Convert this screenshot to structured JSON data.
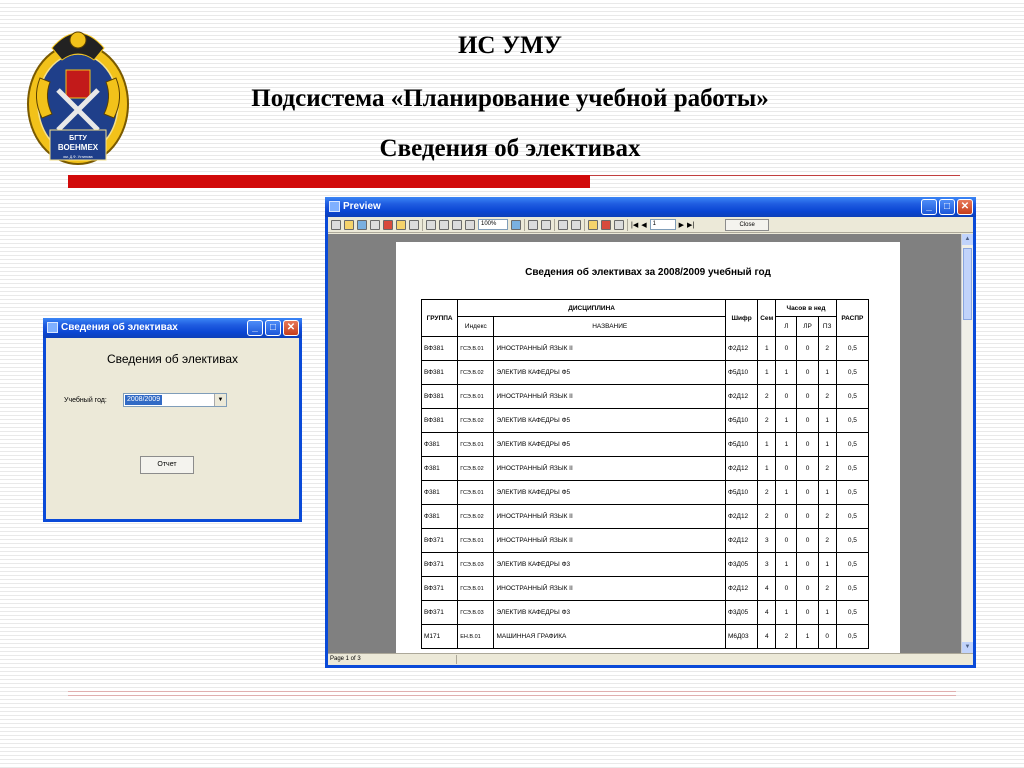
{
  "slide": {
    "title": "ИС УМУ",
    "subtitle": "Подсистема «Планирование учебной работы»",
    "heading": "Сведения об элективах"
  },
  "logo": {
    "text_line1": "БГТУ",
    "text_line2": "ВОЕНМЕХ",
    "text_line3": "им. Д.Ф. Устинова"
  },
  "colors": {
    "accent_red": "#d10a0a",
    "xp_title_blue": "#0a46d4"
  },
  "dialog": {
    "title": "Сведения об элективах",
    "heading": "Сведения об элективах",
    "year_label": "Учебный год:",
    "year_value": "2008/2009",
    "report_button": "Отчет"
  },
  "preview": {
    "title": "Preview",
    "zoom": "100%",
    "page_input": "1",
    "close_button": "Close",
    "status": "Page 1 of 3",
    "report": {
      "title": "Сведения об элективах за 2008/2009 учебный год",
      "headers": {
        "group": "ГРУППА",
        "discipline": "ДИСЦИПЛИНА",
        "index": "Индекс",
        "name": "НАЗВАНИЕ",
        "code": "Шифр",
        "sem": "Сем",
        "hours": "Часов в нед",
        "l": "Л",
        "lr": "ЛР",
        "pz": "ПЗ",
        "raspr": "РАСПР"
      },
      "rows": [
        {
          "group": "ВФ381",
          "index": "ГСЭ.В.01",
          "name": "ИНОСТРАННЫЙ ЯЗЫК II",
          "code": "Ф2Д12",
          "sem": "1",
          "l": "0",
          "lr": "0",
          "pz": "2",
          "raspr": "0,5"
        },
        {
          "group": "ВФ381",
          "index": "ГСЭ.В.02",
          "name": "ЭЛЕКТИВ КАФЕДРЫ  Ф5",
          "code": "Ф5Д10",
          "sem": "1",
          "l": "1",
          "lr": "0",
          "pz": "1",
          "raspr": "0,5"
        },
        {
          "group": "ВФ381",
          "index": "ГСЭ.В.01",
          "name": "ИНОСТРАННЫЙ ЯЗЫК II",
          "code": "Ф2Д12",
          "sem": "2",
          "l": "0",
          "lr": "0",
          "pz": "2",
          "raspr": "0,5"
        },
        {
          "group": "ВФ381",
          "index": "ГСЭ.В.02",
          "name": "ЭЛЕКТИВ КАФЕДРЫ  Ф5",
          "code": "Ф5Д10",
          "sem": "2",
          "l": "1",
          "lr": "0",
          "pz": "1",
          "raspr": "0,5"
        },
        {
          "group": "Ф381",
          "index": "ГСЭ.В.01",
          "name": "ЭЛЕКТИВ КАФЕДРЫ  Ф5",
          "code": "Ф5Д10",
          "sem": "1",
          "l": "1",
          "lr": "0",
          "pz": "1",
          "raspr": "0,5"
        },
        {
          "group": "Ф381",
          "index": "ГСЭ.В.02",
          "name": "ИНОСТРАННЫЙ ЯЗЫК II",
          "code": "Ф2Д12",
          "sem": "1",
          "l": "0",
          "lr": "0",
          "pz": "2",
          "raspr": "0,5"
        },
        {
          "group": "Ф381",
          "index": "ГСЭ.В.01",
          "name": "ЭЛЕКТИВ КАФЕДРЫ  Ф5",
          "code": "Ф5Д10",
          "sem": "2",
          "l": "1",
          "lr": "0",
          "pz": "1",
          "raspr": "0,5"
        },
        {
          "group": "Ф381",
          "index": "ГСЭ.В.02",
          "name": "ИНОСТРАННЫЙ ЯЗЫК II",
          "code": "Ф2Д12",
          "sem": "2",
          "l": "0",
          "lr": "0",
          "pz": "2",
          "raspr": "0,5"
        },
        {
          "group": "ВФ371",
          "index": "ГСЭ.В.01",
          "name": "ИНОСТРАННЫЙ ЯЗЫК II",
          "code": "Ф2Д12",
          "sem": "3",
          "l": "0",
          "lr": "0",
          "pz": "2",
          "raspr": "0,5"
        },
        {
          "group": "ВФ371",
          "index": "ГСЭ.В.03",
          "name": "ЭЛЕКТИВ КАФЕДРЫ Ф3",
          "code": "Ф3Д05",
          "sem": "3",
          "l": "1",
          "lr": "0",
          "pz": "1",
          "raspr": "0,5"
        },
        {
          "group": "ВФ371",
          "index": "ГСЭ.В.01",
          "name": "ИНОСТРАННЫЙ ЯЗЫК II",
          "code": "Ф2Д12",
          "sem": "4",
          "l": "0",
          "lr": "0",
          "pz": "2",
          "raspr": "0,5"
        },
        {
          "group": "ВФ371",
          "index": "ГСЭ.В.03",
          "name": "ЭЛЕКТИВ КАФЕДРЫ Ф3",
          "code": "Ф3Д05",
          "sem": "4",
          "l": "1",
          "lr": "0",
          "pz": "1",
          "raspr": "0,5"
        },
        {
          "group": "М171",
          "index": "ЕН.В.01",
          "name": "МАШИННАЯ ГРАФИКА",
          "code": "М6Д03",
          "sem": "4",
          "l": "2",
          "lr": "1",
          "pz": "0",
          "raspr": "0,5"
        }
      ]
    }
  }
}
